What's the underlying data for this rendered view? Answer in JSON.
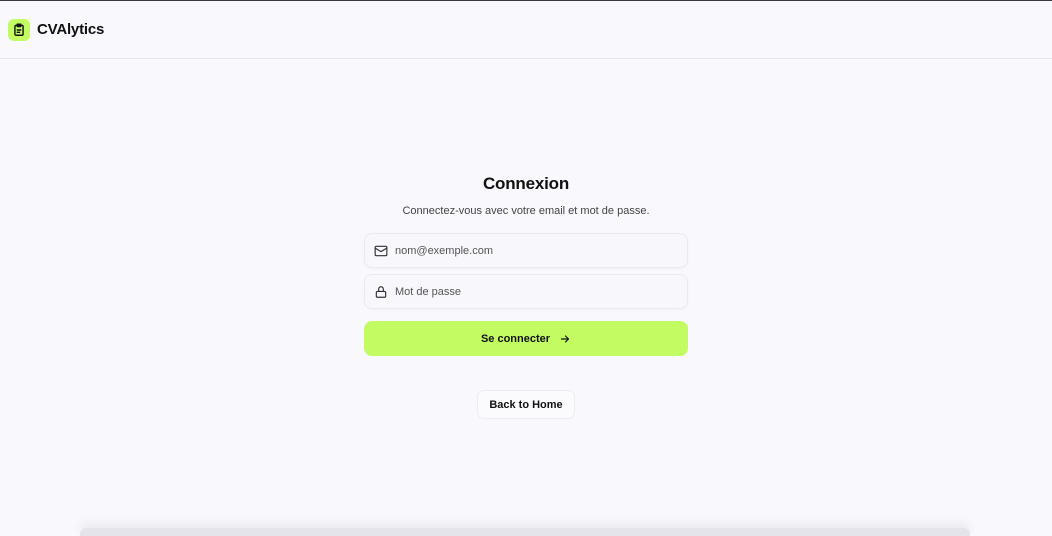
{
  "header": {
    "brand": "CVAlytics",
    "logo_icon": "document-icon",
    "accent_color": "#c2fb62"
  },
  "login": {
    "title": "Connexion",
    "subtitle": "Connectez-vous avec votre email et mot de passe.",
    "email": {
      "value": "",
      "placeholder": "nom@exemple.com",
      "icon": "mail-icon"
    },
    "password": {
      "value": "",
      "placeholder": "Mot de passe",
      "icon": "lock-icon"
    },
    "submit_label": "Se connecter",
    "submit_icon": "arrow-right-icon",
    "back_label": "Back to Home"
  }
}
